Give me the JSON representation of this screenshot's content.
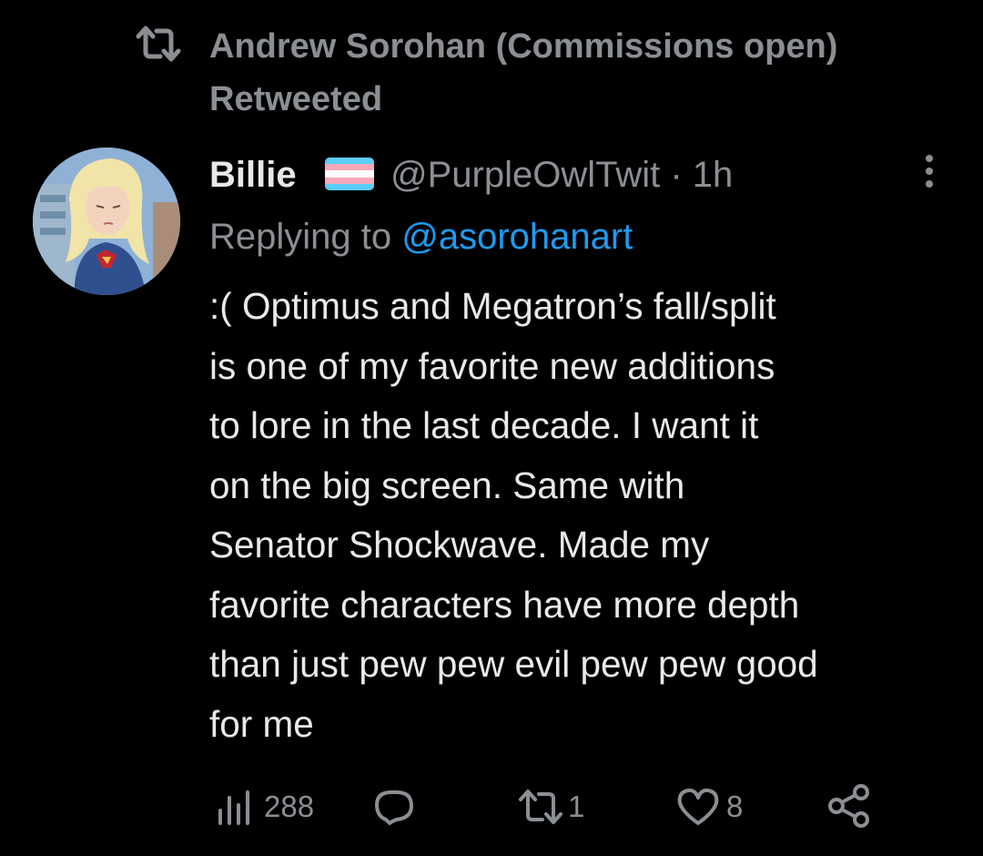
{
  "retweet": {
    "icon": "retweet-icon",
    "text": "Andrew Sorohan (Commissions open) Retweeted"
  },
  "tweet": {
    "avatar": "avatar-image",
    "display_name": "Billie",
    "flag_icon": "transgender-flag-icon",
    "handle": "@PurpleOwlTwit",
    "separator": " · ",
    "time": "1h",
    "replying_prefix": "Replying to ",
    "replying_to": "@asorohanart",
    "body": ":( Optimus and Megatron’s fall/split\nis one of my favorite new additions\nto lore in the last decade. I want it\non the big screen. Same with\nSenator Shockwave. Made my\nfavorite characters have more depth\nthan just pew pew evil pew pew good\nfor me"
  },
  "actions": {
    "views": "288",
    "replies": "",
    "retweets": "1",
    "likes": "8"
  },
  "colors": {
    "background": "#000000",
    "primary_text": "#e7e9ea",
    "secondary_text": "#8b8f94",
    "link": "#1d9bf0",
    "flag_blue": "#5bcefa",
    "flag_pink": "#f5a9b8",
    "flag_white": "#ffffff"
  }
}
